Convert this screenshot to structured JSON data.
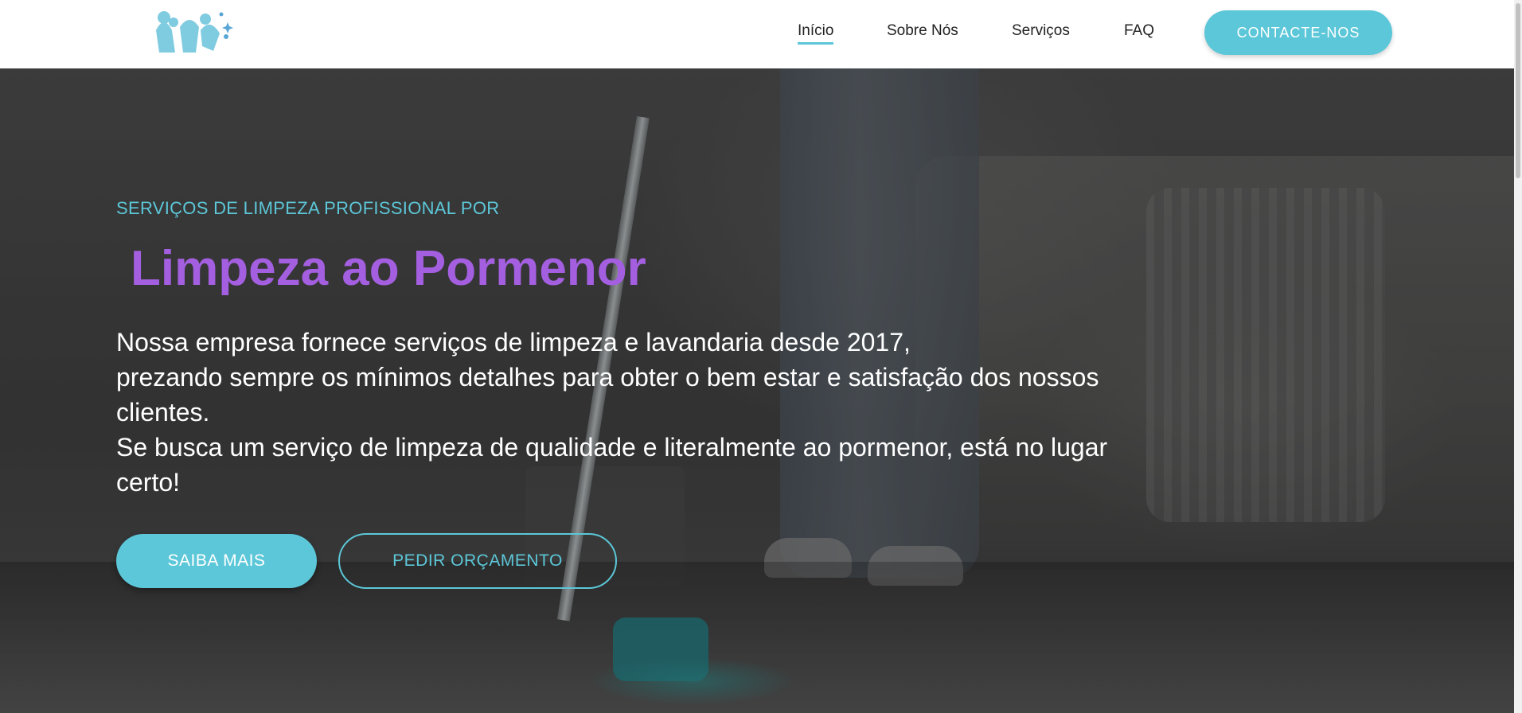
{
  "header": {
    "logo_icon": "cleaning-splash-logo-icon",
    "nav": [
      {
        "label": "Início",
        "active": true
      },
      {
        "label": "Sobre Nós",
        "active": false
      },
      {
        "label": "Serviços",
        "active": false
      },
      {
        "label": "FAQ",
        "active": false
      }
    ],
    "cta_label": "CONTACTE-NOS"
  },
  "hero": {
    "kicker": "SERVIÇOS DE LIMPEZA PROFISSIONAL POR",
    "headline": "Limpeza ao Pormenor",
    "description_lines": [
      "Nossa empresa fornece serviços de limpeza e lavandaria desde 2017,",
      "prezando sempre os mínimos detalhes para obter o bem estar e satisfação dos nossos clientes.",
      "Se busca um serviço de limpeza de qualidade e literalmente ao pormenor, está no lugar certo!"
    ],
    "primary_button": "SAIBA MAIS",
    "secondary_button": "PEDIR ORÇAMENTO"
  },
  "colors": {
    "accent": "#5cc7d8",
    "headline": "#a45fe0",
    "header_bg": "#ffffff"
  }
}
